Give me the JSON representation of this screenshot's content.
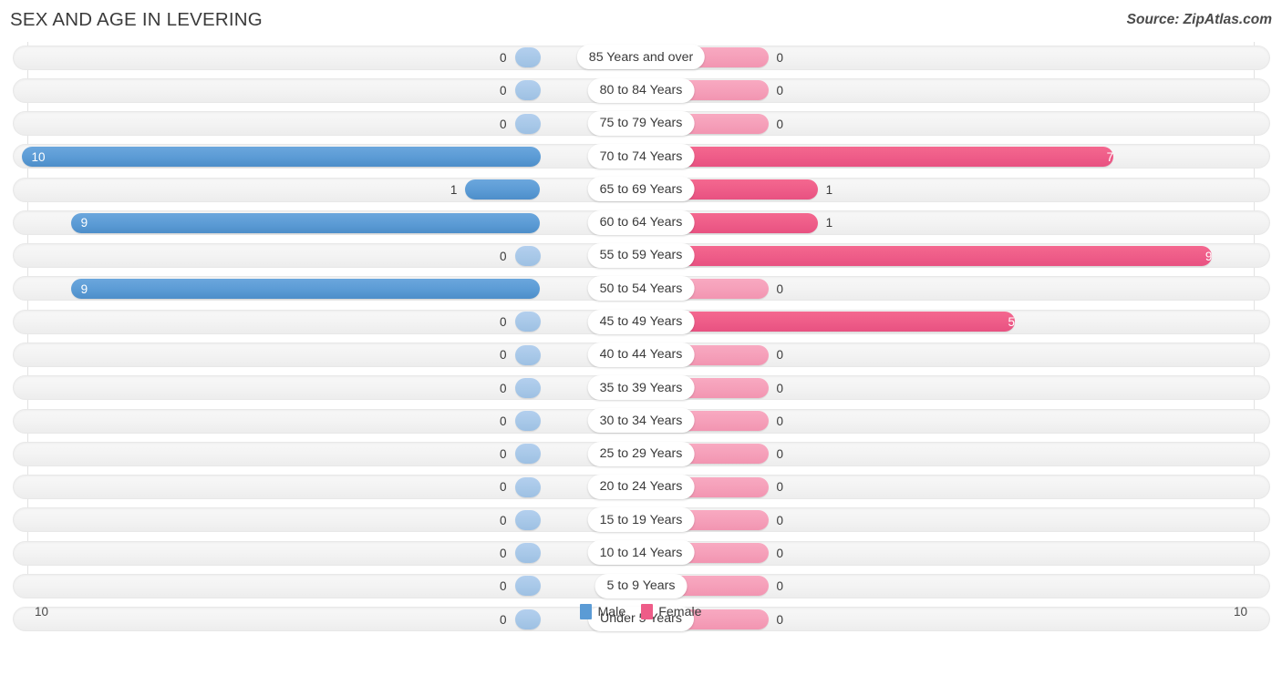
{
  "header": {
    "title": "SEX AND AGE IN LEVERING",
    "source": "Source: ZipAtlas.com"
  },
  "legend": {
    "male_label": "Male",
    "female_label": "Female",
    "male_color": "#5b9bd5",
    "female_color": "#ee5c88"
  },
  "axis": {
    "left_tick": "10",
    "right_tick": "10"
  },
  "chart_data": {
    "type": "bar",
    "subtype": "population-pyramid",
    "title": "SEX AND AGE IN LEVERING",
    "xlabel": "",
    "ylabel": "",
    "xlim": [
      10,
      10
    ],
    "grid": true,
    "legend_position": "bottom-center",
    "categories": [
      "85 Years and over",
      "80 to 84 Years",
      "75 to 79 Years",
      "70 to 74 Years",
      "65 to 69 Years",
      "60 to 64 Years",
      "55 to 59 Years",
      "50 to 54 Years",
      "45 to 49 Years",
      "40 to 44 Years",
      "35 to 39 Years",
      "30 to 34 Years",
      "25 to 29 Years",
      "20 to 24 Years",
      "15 to 19 Years",
      "10 to 14 Years",
      "5 to 9 Years",
      "Under 5 Years"
    ],
    "series": [
      {
        "name": "Male",
        "color": "#5b9bd5",
        "values": [
          0,
          0,
          0,
          10,
          1,
          9,
          0,
          9,
          0,
          0,
          0,
          0,
          0,
          0,
          0,
          0,
          0,
          0
        ]
      },
      {
        "name": "Female",
        "color": "#ee5c88",
        "values": [
          0,
          0,
          0,
          7,
          1,
          1,
          9,
          0,
          5,
          0,
          0,
          0,
          0,
          0,
          0,
          0,
          0,
          0
        ]
      }
    ]
  },
  "rows": [
    {
      "label": "85 Years and over",
      "male": "0",
      "female": "0"
    },
    {
      "label": "80 to 84 Years",
      "male": "0",
      "female": "0"
    },
    {
      "label": "75 to 79 Years",
      "male": "0",
      "female": "0"
    },
    {
      "label": "70 to 74 Years",
      "male": "10",
      "female": "7"
    },
    {
      "label": "65 to 69 Years",
      "male": "1",
      "female": "1"
    },
    {
      "label": "60 to 64 Years",
      "male": "9",
      "female": "1"
    },
    {
      "label": "55 to 59 Years",
      "male": "0",
      "female": "9"
    },
    {
      "label": "50 to 54 Years",
      "male": "9",
      "female": "0"
    },
    {
      "label": "45 to 49 Years",
      "male": "0",
      "female": "5"
    },
    {
      "label": "40 to 44 Years",
      "male": "0",
      "female": "0"
    },
    {
      "label": "35 to 39 Years",
      "male": "0",
      "female": "0"
    },
    {
      "label": "30 to 34 Years",
      "male": "0",
      "female": "0"
    },
    {
      "label": "25 to 29 Years",
      "male": "0",
      "female": "0"
    },
    {
      "label": "20 to 24 Years",
      "male": "0",
      "female": "0"
    },
    {
      "label": "15 to 19 Years",
      "male": "0",
      "female": "0"
    },
    {
      "label": "10 to 14 Years",
      "male": "0",
      "female": "0"
    },
    {
      "label": "5 to 9 Years",
      "male": "0",
      "female": "0"
    },
    {
      "label": "Under 5 Years",
      "male": "0",
      "female": "0"
    }
  ]
}
